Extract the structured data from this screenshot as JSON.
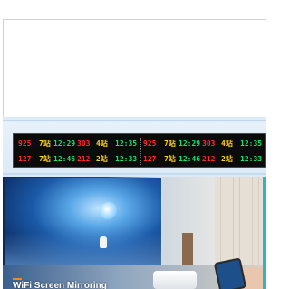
{
  "led_display": {
    "colors": {
      "red": "#ff2a2a",
      "green": "#19e36a",
      "yellow": "#ffd21a"
    },
    "row1": [
      {
        "text": "925",
        "color": "red"
      },
      {
        "text": "7站",
        "color": "yellow"
      },
      {
        "text": "12:29",
        "color": "green"
      },
      {
        "text": "303",
        "color": "red"
      },
      {
        "text": "4站",
        "color": "yellow"
      },
      {
        "text": "12:35",
        "color": "green"
      },
      {
        "text": "925",
        "color": "red"
      },
      {
        "text": "7站",
        "color": "yellow"
      },
      {
        "text": "12:29",
        "color": "green"
      },
      {
        "text": "303",
        "color": "red"
      },
      {
        "text": "4站",
        "color": "yellow"
      },
      {
        "text": "12:35",
        "color": "green"
      }
    ],
    "row2": [
      {
        "text": "127",
        "color": "red"
      },
      {
        "text": "7站",
        "color": "yellow"
      },
      {
        "text": "12:46",
        "color": "green"
      },
      {
        "text": "212",
        "color": "red"
      },
      {
        "text": "2站",
        "color": "yellow"
      },
      {
        "text": "12:33",
        "color": "green"
      },
      {
        "text": "127",
        "color": "red"
      },
      {
        "text": "7站",
        "color": "yellow"
      },
      {
        "text": "12:46",
        "color": "green"
      },
      {
        "text": "212",
        "color": "red"
      },
      {
        "text": "2站",
        "color": "yellow"
      },
      {
        "text": "12:33",
        "color": "green"
      }
    ]
  },
  "banner": {
    "caption": "WiFi Screen Mirroring",
    "accent_color": "#f08a1a"
  }
}
